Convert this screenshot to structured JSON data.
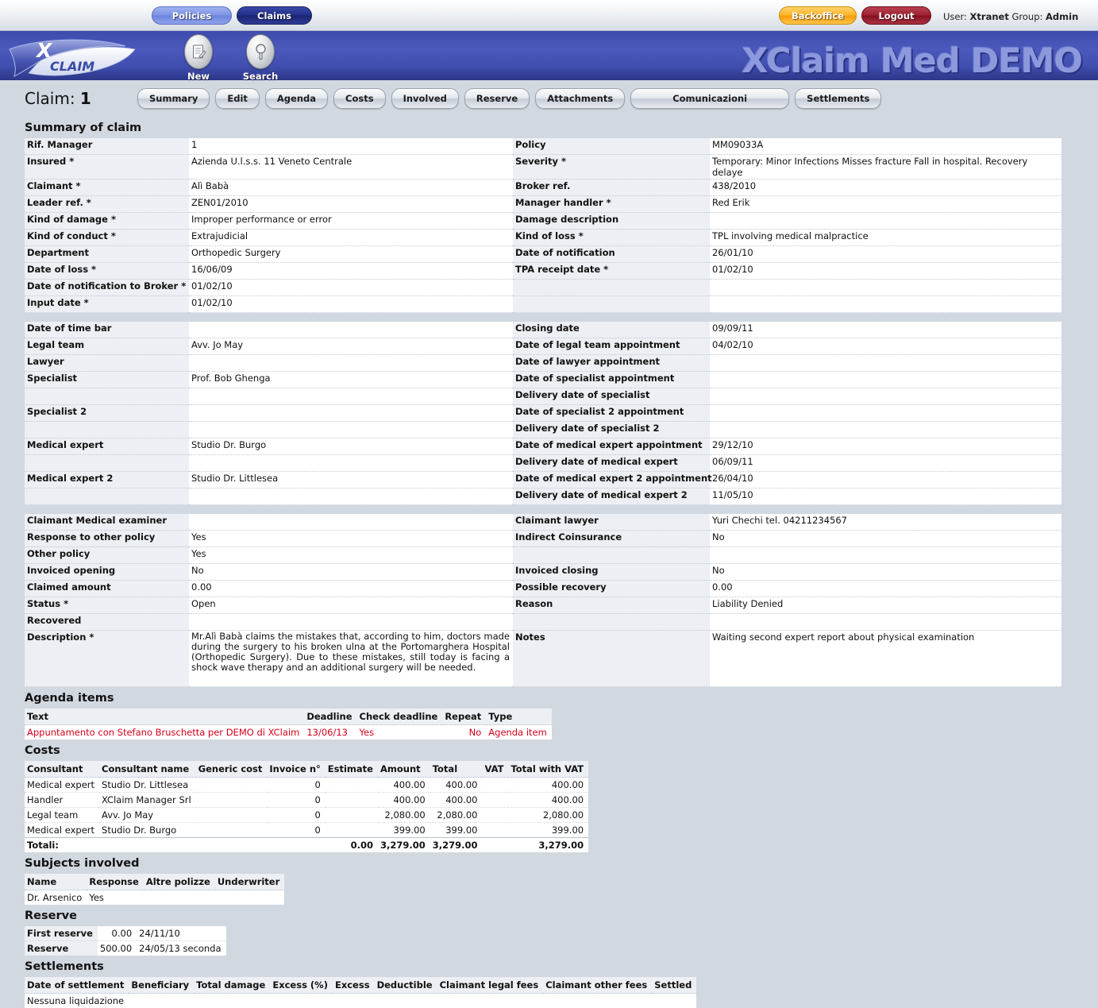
{
  "topnav": {
    "policies": "Policies",
    "claims": "Claims",
    "backoffice": "Backoffice",
    "logout": "Logout",
    "user_prefix": "User:",
    "user_name": "Xtranet",
    "group_prefix": "Group:",
    "group_name": "Admin"
  },
  "banner": {
    "title": "XClaim Med DEMO",
    "logo_x": "X",
    "logo_claim": "CLAIM",
    "icons": [
      {
        "label": "New",
        "icon": "new-document-icon"
      },
      {
        "label": "Search",
        "icon": "magnifier-icon"
      }
    ]
  },
  "claim": {
    "label": "Claim:",
    "number": "1",
    "tabs": [
      "Summary",
      "Edit",
      "Agenda",
      "Costs",
      "Involved",
      "Reserve",
      "Attachments",
      "Comunicazioni",
      "Settlements"
    ]
  },
  "sections": {
    "summary": "Summary of claim",
    "agenda": "Agenda items",
    "costs": "Costs",
    "subjects": "Subjects involved",
    "reserve": "Reserve",
    "settlements": "Settlements"
  },
  "summary_rows": [
    {
      "l1": "Rif. Manager",
      "v1": "1",
      "l2": "Policy",
      "v2": "MM09033A"
    },
    {
      "l1": "Insured *",
      "v1": "Azienda U.l.s.s. 11 Veneto Centrale",
      "l2": "Severity *",
      "v2": "Temporary: Minor Infections Misses fracture Fall in hospital. Recovery delaye"
    },
    {
      "l1": "Claimant *",
      "v1": "Alì Babà",
      "l2": "Broker ref.",
      "v2": "438/2010"
    },
    {
      "l1": "Leader ref. *",
      "v1": "ZEN01/2010",
      "l2": "Manager handler *",
      "v2": "Red Erik"
    },
    {
      "l1": "Kind of damage *",
      "v1": "Improper performance or error",
      "l2": "Damage description",
      "v2": ""
    },
    {
      "l1": "Kind of conduct *",
      "v1": "Extrajudicial",
      "l2": "Kind of loss *",
      "v2": "TPL involving medical malpractice"
    },
    {
      "l1": "Department",
      "v1": "Orthopedic Surgery",
      "l2": "Date of notification",
      "v2": "26/01/10"
    },
    {
      "l1": "Date of loss *",
      "v1": "16/06/09",
      "l2": "TPA receipt date *",
      "v2": "01/02/10"
    },
    {
      "l1": "Date of notification to Broker *",
      "v1": "01/02/10",
      "l2": "",
      "v2": ""
    },
    {
      "l1": "Input date *",
      "v1": "01/02/10",
      "l2": "",
      "v2": ""
    },
    {
      "spacer": true
    },
    {
      "l1": "Date of time bar",
      "v1": "",
      "l2": "Closing date",
      "v2": "09/09/11"
    },
    {
      "l1": "Legal team",
      "v1": "Avv. Jo May",
      "l2": "Date of legal team appointment",
      "v2": "04/02/10"
    },
    {
      "l1": "Lawyer",
      "v1": "",
      "l2": "Date of lawyer appointment",
      "v2": ""
    },
    {
      "l1": "Specialist",
      "v1": "Prof. Bob Ghenga",
      "l2": "Date of specialist appointment",
      "v2": ""
    },
    {
      "l1": "",
      "v1": "",
      "l2": "Delivery date of specialist",
      "v2": ""
    },
    {
      "l1": "Specialist 2",
      "v1": "",
      "l2": "Date of specialist 2 appointment",
      "v2": ""
    },
    {
      "l1": "",
      "v1": "",
      "l2": "Delivery date of specialist 2",
      "v2": ""
    },
    {
      "l1": "Medical expert",
      "v1": "Studio Dr. Burgo",
      "l2": "Date of medical expert appointment",
      "v2": "29/12/10"
    },
    {
      "l1": "",
      "v1": "",
      "l2": "Delivery date of medical expert",
      "v2": "06/09/11"
    },
    {
      "l1": "Medical expert 2",
      "v1": "Studio Dr. Littlesea",
      "l2": "Date of medical expert 2 appointment",
      "v2": "26/04/10"
    },
    {
      "l1": "",
      "v1": "",
      "l2": "Delivery date of medical expert 2",
      "v2": "11/05/10"
    },
    {
      "spacer": true
    },
    {
      "l1": "Claimant Medical examiner",
      "v1": "",
      "l2": "Claimant lawyer",
      "v2": "Yuri Chechi tel. 04211234567"
    },
    {
      "l1": "Response to other policy",
      "v1": "Yes",
      "l2": "Indirect Coinsurance",
      "v2": "No"
    },
    {
      "l1": "Other policy",
      "v1": "Yes",
      "l2": "",
      "v2": ""
    },
    {
      "l1": "Invoiced opening",
      "v1": "No",
      "l2": "Invoiced closing",
      "v2": "No"
    },
    {
      "l1": "Claimed amount",
      "v1": "0.00",
      "l2": "Possible recovery",
      "v2": "0.00"
    },
    {
      "l1": "Status *",
      "v1": "Open",
      "l2": "Reason",
      "v2": "Liability Denied"
    },
    {
      "l1": "Recovered",
      "v1": "",
      "l2": "",
      "v2": ""
    }
  ],
  "summary_last": {
    "l1": "Description *",
    "v1": "Mr.Alì Babà claims the mistakes that, according to him, doctors made during the surgery to his broken ulna at the Portomarghera Hospital (Orthopedic Surgery). Due to these mistakes, still today is facing a shock wave therapy and an additional surgery will be needed.",
    "l2": "Notes",
    "v2": "Waiting second expert report about physical examination"
  },
  "agenda": {
    "headers": [
      "Text",
      "Deadline",
      "Check deadline",
      "Repeat",
      "Type"
    ],
    "rows": [
      {
        "text": "Appuntamento con Stefano Bruschetta per DEMO di XClaim",
        "deadline": "13/06/13",
        "check_deadline": "Yes",
        "repeat": "No",
        "type": "Agenda item"
      }
    ]
  },
  "costs": {
    "headers": [
      "Consultant",
      "Consultant name",
      "Generic cost",
      "Invoice n°",
      "Estimate",
      "Amount",
      "Total",
      "VAT",
      "Total with VAT"
    ],
    "rows": [
      {
        "consultant": "Medical expert",
        "name": "Studio Dr. Littlesea",
        "generic": "",
        "invoice": "0",
        "estimate": "",
        "amount": "400.00",
        "total": "400.00",
        "vat": "",
        "total_vat": "400.00"
      },
      {
        "consultant": "Handler",
        "name": "XClaim Manager Srl",
        "generic": "",
        "invoice": "0",
        "estimate": "",
        "amount": "400.00",
        "total": "400.00",
        "vat": "",
        "total_vat": "400.00"
      },
      {
        "consultant": "Legal team",
        "name": "Avv. Jo May",
        "generic": "",
        "invoice": "0",
        "estimate": "",
        "amount": "2,080.00",
        "total": "2,080.00",
        "vat": "",
        "total_vat": "2,080.00"
      },
      {
        "consultant": "Medical expert",
        "name": "Studio Dr. Burgo",
        "generic": "",
        "invoice": "0",
        "estimate": "",
        "amount": "399.00",
        "total": "399.00",
        "vat": "",
        "total_vat": "399.00"
      }
    ],
    "totals": {
      "label": "Totali:",
      "estimate": "0.00",
      "amount": "3,279.00",
      "total": "3,279.00",
      "vat": "",
      "total_vat": "3,279.00"
    }
  },
  "subjects": {
    "headers": [
      "Name",
      "Response",
      "Altre polizze",
      "Underwriter"
    ],
    "rows": [
      {
        "name": "Dr. Arsenico",
        "response": "Yes",
        "altre": "",
        "underwriter": ""
      }
    ]
  },
  "reserve": {
    "rows": [
      {
        "label": "First reserve",
        "amount": "0.00",
        "date": "24/11/10",
        "note": ""
      },
      {
        "label": "Reserve",
        "amount": "500.00",
        "date": "24/05/13",
        "note": "seconda"
      }
    ]
  },
  "settlements": {
    "headers": [
      "Date of settlement",
      "Beneficiary",
      "Total damage",
      "Excess (%)",
      "Excess",
      "Deductible",
      "Claimant legal fees",
      "Claimant other fees",
      "Settled"
    ],
    "empty_message": "Nessuna liquidazione"
  }
}
